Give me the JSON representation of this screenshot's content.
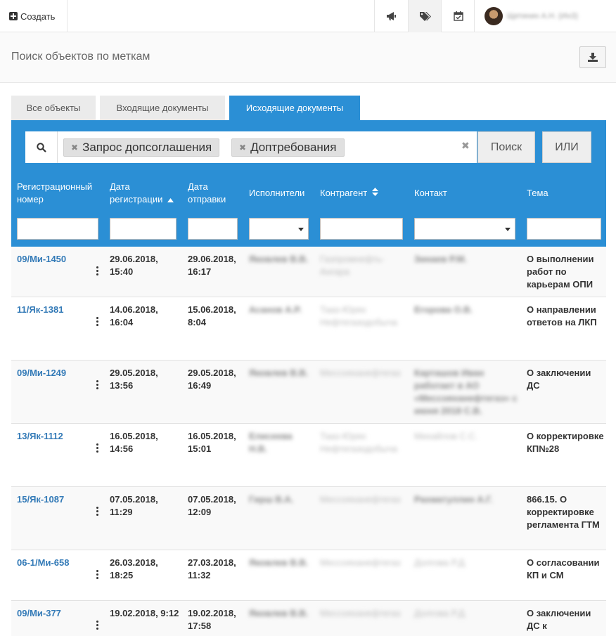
{
  "topbar": {
    "create_label": "Создать",
    "icons": [
      "megaphone-icon",
      "tags-icon",
      "calendar-check-icon"
    ],
    "user_name": "Щетинин А.Н. (ИнЗ)"
  },
  "page": {
    "title": "Поиск объектов по меткам"
  },
  "tabs": [
    {
      "label": "Все объекты",
      "active": false
    },
    {
      "label": "Входящие документы",
      "active": false
    },
    {
      "label": "Исходящие документы",
      "active": true
    }
  ],
  "search": {
    "tags": [
      "Запрос допсоглашения",
      "Доптребования"
    ],
    "search_button": "Поиск",
    "or_button": "ИЛИ"
  },
  "columns": [
    {
      "label": "Регистрационный номер"
    },
    {
      "label": "Дата регистрации"
    },
    {
      "label": "Дата отправки"
    },
    {
      "label": "Исполнители"
    },
    {
      "label": "Контрагент"
    },
    {
      "label": "Контакт"
    },
    {
      "label": "Тема"
    }
  ],
  "rows": [
    {
      "reg": "09/Ми-1450",
      "reg_date": "29.06.2018, 15:40",
      "send_date": "29.06.2018, 16:17",
      "executor": "Яковлев В.В.",
      "counterparty": "Газпромнефть-Ангара",
      "contact": "Зинаев Р.М.",
      "subject": "О выполнении работ по карьерам ОПИ"
    },
    {
      "reg": "11/Як-1381",
      "reg_date": "14.06.2018, 16:04",
      "send_date": "15.06.2018, 8:04",
      "executor": "Асанов А.Р.",
      "counterparty": "Тааз-Юрях Нефтегазодобыча",
      "contact": "Егорова О.В.",
      "subject": "О направлении ответов на ЛКП"
    },
    {
      "reg": "09/Ми-1249",
      "reg_date": "29.05.2018, 13:56",
      "send_date": "29.05.2018, 16:49",
      "executor": "Яковлев В.В.",
      "counterparty": "Мессояханефтегаз",
      "contact": "Карташов Иван работает в АО «Мессояханефтегаз» с июня 2018 С.В.",
      "subject": "О заключении ДС"
    },
    {
      "reg": "13/Як-1112",
      "reg_date": "16.05.2018, 14:56",
      "send_date": "16.05.2018, 15:01",
      "executor": "Елисеева Н.В.",
      "counterparty": "Тааз-Юрях Нефтегазодобыча",
      "contact": "Михайлов С.С.",
      "subject": "О корректировке КП№28"
    },
    {
      "reg": "15/Як-1087",
      "reg_date": "07.05.2018, 11:29",
      "send_date": "07.05.2018, 12:09",
      "executor": "Гирш В.А.",
      "counterparty": "Мессояханефтегаз",
      "contact": "Рахматуллин А.Г.",
      "subject": "866.15. О корректировке регламента ГТМ"
    },
    {
      "reg": "06-1/Ми-658",
      "reg_date": "26.03.2018, 18:25",
      "send_date": "27.03.2018, 11:32",
      "executor": "Яковлев В.В.",
      "counterparty": "Мессояханефтегаз",
      "contact": "Долгова Р.Д.",
      "subject": "О согласовании КП и СМ"
    },
    {
      "reg": "09/Ми-377",
      "reg_date": "19.02.2018, 9:12",
      "send_date": "19.02.2018, 17:58",
      "executor": "Яковлев В.В.",
      "counterparty": "Мессояханефтегаз",
      "contact": "Долгова Р.Д.",
      "subject": "О заключении ДС к"
    }
  ]
}
